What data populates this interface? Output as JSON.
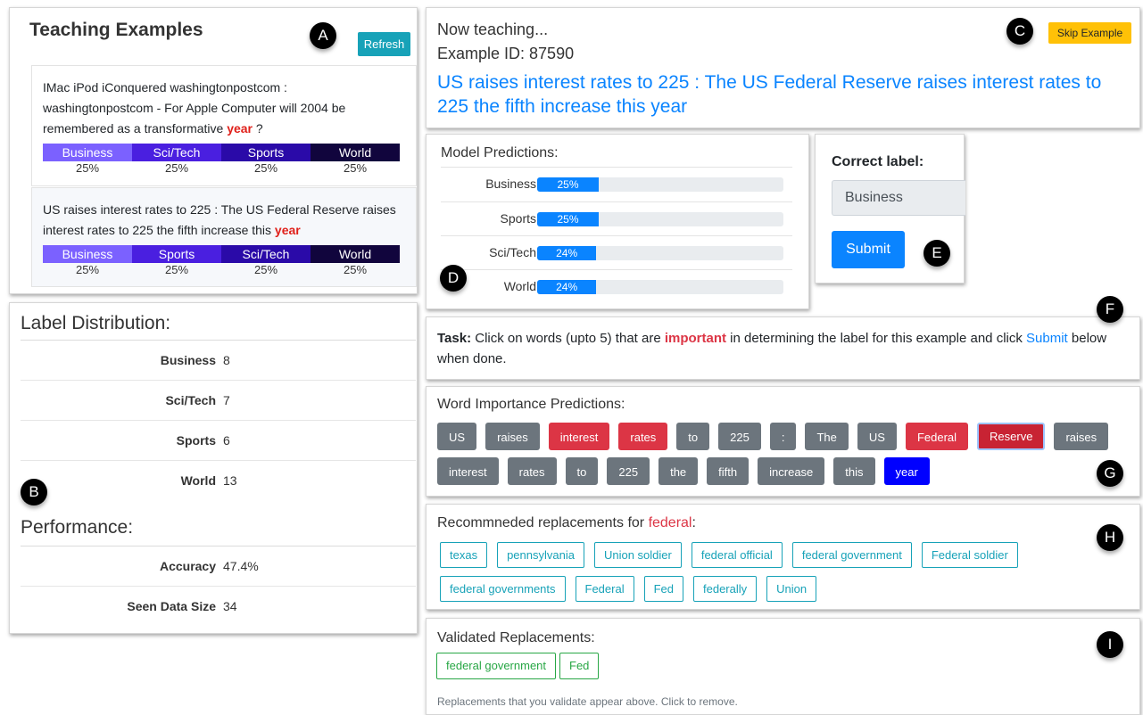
{
  "markers": [
    "A",
    "B",
    "C",
    "D",
    "E",
    "F",
    "G",
    "H",
    "I"
  ],
  "teaching": {
    "title": "Teaching Examples",
    "refresh_label": "Refresh",
    "examples": [
      {
        "text_before": "IMac iPod iConquered washingtonpostcom : washingtonpostcom - For Apple Computer will 2004 be remembered as a transformative ",
        "highlight": "year",
        "text_after": " ?",
        "labels": [
          "Business",
          "Sci/Tech",
          "Sports",
          "World"
        ],
        "percents": [
          "25%",
          "25%",
          "25%",
          "25%"
        ]
      },
      {
        "text_before": "US raises interest rates to 225 : The US Federal Reserve raises interest rates to 225 the fifth increase this ",
        "highlight": "year",
        "text_after": "",
        "labels": [
          "Business",
          "Sports",
          "Sci/Tech",
          "World"
        ],
        "percents": [
          "25%",
          "25%",
          "25%",
          "25%"
        ]
      }
    ],
    "segment_colors": [
      "#7b61ff",
      "#4a1fe0",
      "#2a0aa8",
      "#11053d"
    ]
  },
  "distribution": {
    "title": "Label Distribution:",
    "rows": [
      {
        "label": "Business",
        "value": "8"
      },
      {
        "label": "Sci/Tech",
        "value": "7"
      },
      {
        "label": "Sports",
        "value": "6"
      },
      {
        "label": "World",
        "value": "13"
      }
    ]
  },
  "performance": {
    "title": "Performance:",
    "rows": [
      {
        "label": "Accuracy",
        "value": "47.4%"
      },
      {
        "label": "Seen Data Size",
        "value": "34"
      }
    ]
  },
  "now": {
    "label1": "Now teaching...",
    "label2": "Example ID: 87590",
    "sentence": "US raises interest rates to 225 : The US Federal Reserve raises interest rates to 225 the fifth increase this year",
    "skip_label": "Skip Example"
  },
  "predictions": {
    "title": "Model Predictions:",
    "rows": [
      {
        "label": "Business",
        "text": "25%",
        "fraction": 0.25
      },
      {
        "label": "Sports",
        "text": "25%",
        "fraction": 0.25
      },
      {
        "label": "Sci/Tech",
        "text": "24%",
        "fraction": 0.24
      },
      {
        "label": "World",
        "text": "24%",
        "fraction": 0.24
      }
    ]
  },
  "correct": {
    "title": "Correct label:",
    "value": "Business",
    "submit_label": "Submit"
  },
  "task": {
    "prefix": "Task:",
    "part1": " Click on words (upto 5) that are ",
    "important": "important",
    "part2": " in determining the label for this example and click ",
    "submit_link": "Submit",
    "part3": " below when done."
  },
  "word_importance": {
    "title": "Word Importance Predictions:",
    "words": [
      {
        "w": "US",
        "s": "none"
      },
      {
        "w": "raises",
        "s": "none"
      },
      {
        "w": "interest",
        "s": "imp"
      },
      {
        "w": "rates",
        "s": "imp"
      },
      {
        "w": "to",
        "s": "none"
      },
      {
        "w": "225",
        "s": "none"
      },
      {
        "w": ":",
        "s": "none"
      },
      {
        "w": "The",
        "s": "none"
      },
      {
        "w": "US",
        "s": "none"
      },
      {
        "w": "Federal",
        "s": "imp"
      },
      {
        "w": "Reserve",
        "s": "sel"
      },
      {
        "w": "raises",
        "s": "none"
      },
      {
        "w": "interest",
        "s": "none"
      },
      {
        "w": "rates",
        "s": "none"
      },
      {
        "w": "to",
        "s": "none"
      },
      {
        "w": "225",
        "s": "none"
      },
      {
        "w": "the",
        "s": "none"
      },
      {
        "w": "fifth",
        "s": "none"
      },
      {
        "w": "increase",
        "s": "none"
      },
      {
        "w": "this",
        "s": "none"
      },
      {
        "w": "year",
        "s": "dist"
      }
    ]
  },
  "recommended": {
    "title_prefix": "Recommneded replacements for ",
    "word": "federal",
    "title_suffix": ":",
    "items": [
      "texas",
      "pennsylvania",
      "Union soldier",
      "federal official",
      "federal government",
      "Federal soldier",
      "federal governments",
      "Federal",
      "Fed",
      "federally",
      "Union"
    ]
  },
  "validated": {
    "title": "Validated Replacements:",
    "items": [
      "federal government",
      "Fed"
    ],
    "note": "Replacements that you validate appear above. Click to remove."
  }
}
